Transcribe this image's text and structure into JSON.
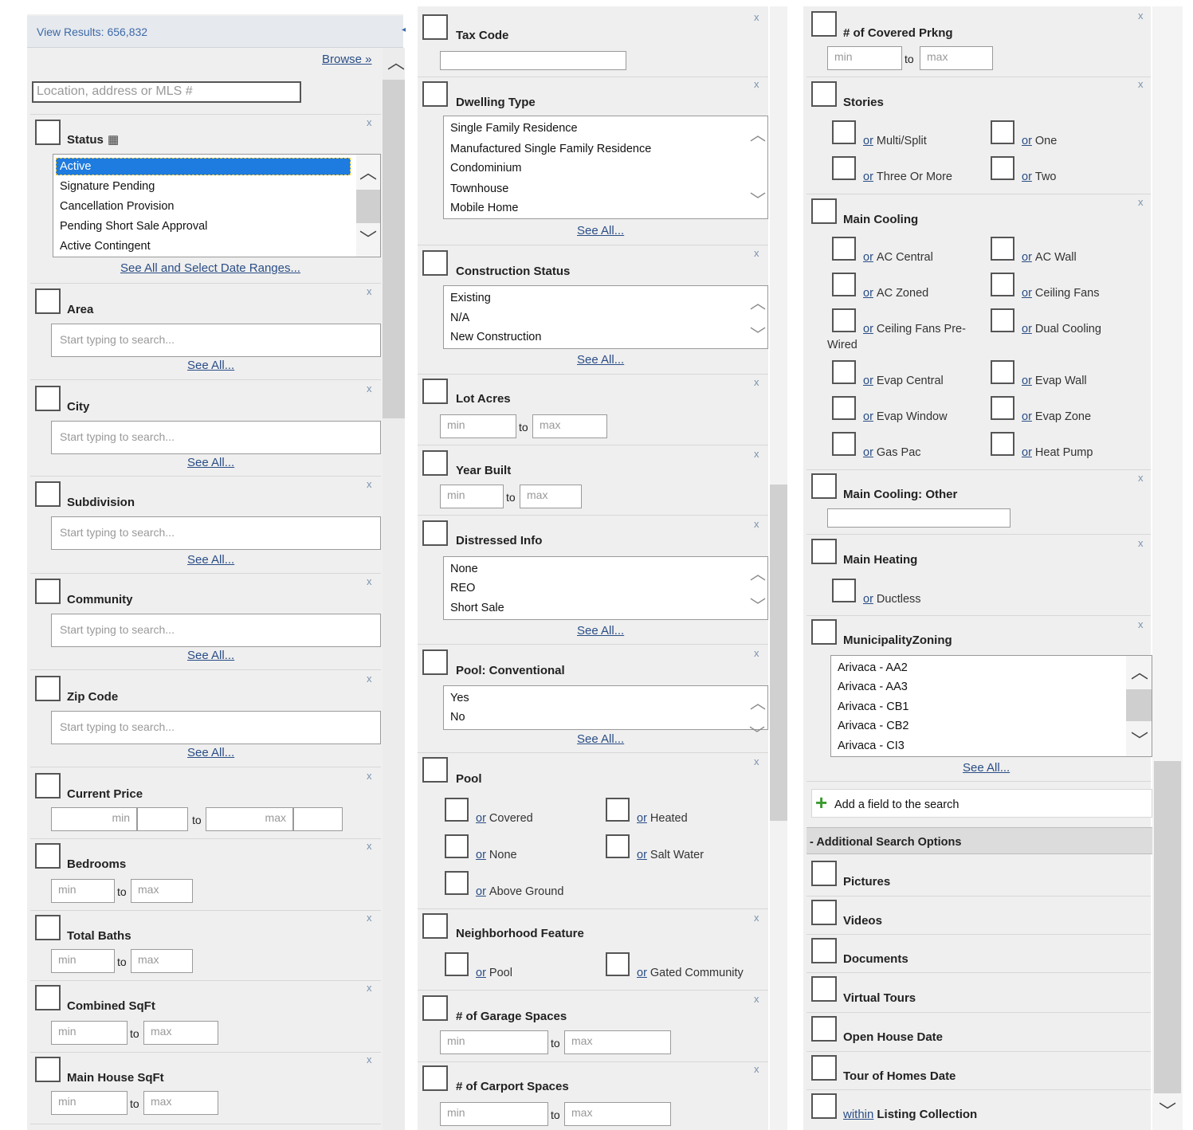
{
  "left": {
    "view_results": "View Results: 656,832",
    "browse": "Browse »",
    "search_placeholder": "Location, address or MLS #",
    "status_label": "Status",
    "status_options": [
      "Active",
      "Signature Pending",
      "Cancellation Provision",
      "Pending Short Sale Approval",
      "Active Contingent"
    ],
    "status_see_all": "See All and Select Date Ranges...",
    "type_placeholder": "Start typing to search...",
    "see_all": "See All...",
    "area_label": "Area",
    "city_label": "City",
    "subdivision_label": "Subdivision",
    "community_label": "Community",
    "zip_label": "Zip Code",
    "price_label": "Current Price",
    "bedrooms_label": "Bedrooms",
    "baths_label": "Total Baths",
    "sqft_label": "Combined SqFt",
    "main_sqft_label": "Main House SqFt",
    "min": "min",
    "max": "max",
    "to": "to",
    "x": "x"
  },
  "middle": {
    "tax_code_label": "Tax Code",
    "dwelling_label": "Dwelling Type",
    "dwelling_options": [
      "Single Family Residence",
      "Manufactured Single Family Residence",
      "Condominium",
      "Townhouse",
      "Mobile Home"
    ],
    "construction_label": "Construction Status",
    "construction_options": [
      "Existing",
      "N/A",
      "New Construction"
    ],
    "lot_acres_label": "Lot Acres",
    "year_built_label": "Year Built",
    "distressed_label": "Distressed Info",
    "distressed_options": [
      "None",
      "REO",
      "Short Sale"
    ],
    "pool_conv_label": "Pool: Conventional",
    "pool_conv_options": [
      "Yes",
      "No"
    ],
    "pool_label": "Pool",
    "pool_opts": [
      "Covered",
      "Heated",
      "None",
      "Salt Water",
      "Above Ground"
    ],
    "neighborhood_label": "Neighborhood Feature",
    "neighborhood_opts": [
      "Pool",
      "Gated Community"
    ],
    "garage_label": "# of Garage Spaces",
    "carport_label": "# of Carport Spaces",
    "or": "or"
  },
  "right": {
    "covered_label": "# of Covered Prkng",
    "stories_label": "Stories",
    "stories_opts": [
      "Multi/Split",
      "One",
      "Three Or More",
      "Two"
    ],
    "cooling_label": "Main Cooling",
    "cooling_opts": [
      "AC Central",
      "AC Wall",
      "AC Zoned",
      "Ceiling Fans",
      "Ceiling Fans Pre-",
      "Wired",
      "Dual Cooling",
      "Evap Central",
      "Evap Wall",
      "Evap Window",
      "Evap Zone",
      "Gas Pac",
      "Heat Pump"
    ],
    "cooling_other_label": "Main Cooling: Other",
    "heating_label": "Main Heating",
    "heating_opts": [
      "Ductless"
    ],
    "zoning_label": "MunicipalityZoning",
    "zoning_options": [
      "Arivaca - AA2",
      "Arivaca - AA3",
      "Arivaca - CB1",
      "Arivaca - CB2",
      "Arivaca - CI3"
    ],
    "add_field": "Add a field to the search",
    "additional_header": "- Additional Search Options",
    "extras": [
      "Pictures",
      "Videos",
      "Documents",
      "Virtual Tours",
      "Open House Date",
      "Tour of Homes Date"
    ],
    "within": "within",
    "listing_collection": "Listing Collection",
    "accent": "#3a9a2e",
    "selected_bg": "#1e7be0"
  }
}
